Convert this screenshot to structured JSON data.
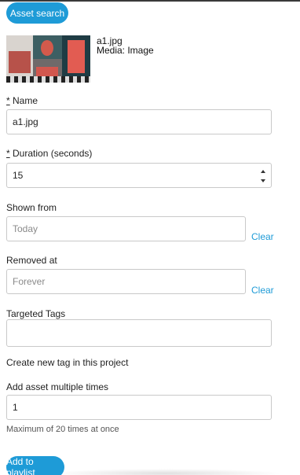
{
  "header": {
    "asset_search_label": "Asset search"
  },
  "asset": {
    "thumbnail_icon": "image-thumbnail",
    "filename": "a1.jpg",
    "media_line": "Media: Image"
  },
  "form": {
    "name": {
      "required_mark": "*",
      "label": "Name",
      "value": "a1.jpg"
    },
    "duration": {
      "required_mark": "*",
      "label": "Duration (seconds)",
      "value": "15"
    },
    "shown_from": {
      "label": "Shown from",
      "placeholder": "Today",
      "clear_label": "Clear"
    },
    "removed_at": {
      "label": "Removed at",
      "placeholder": "Forever",
      "clear_label": "Clear"
    },
    "targeted_tags": {
      "label": "Targeted Tags",
      "value": ""
    },
    "create_tag_text": "Create new tag in this project",
    "multiple": {
      "label": "Add asset multiple times",
      "value": "1",
      "hint": "Maximum of 20 times at once"
    }
  },
  "footer": {
    "add_to_playlist_label": "Add to playlist"
  },
  "colors": {
    "accent": "#1e9bd7",
    "border": "#c9c9c9"
  }
}
